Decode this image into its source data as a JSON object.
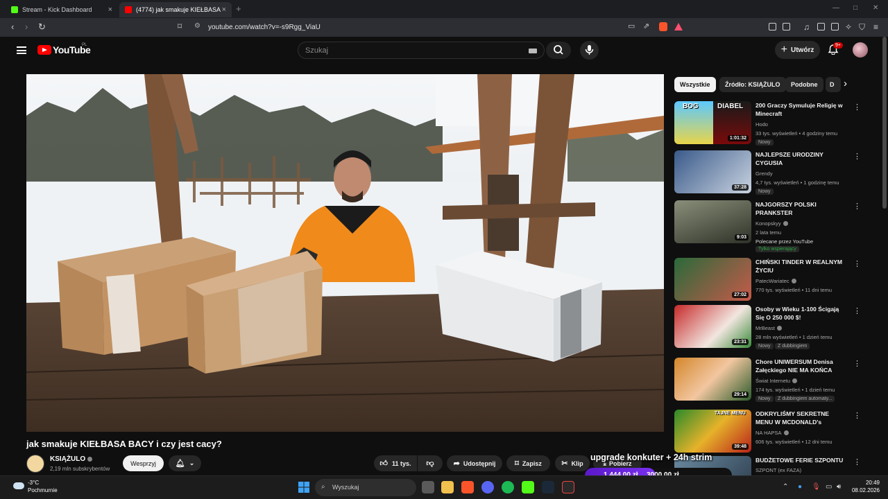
{
  "browser": {
    "tabs": [
      {
        "title": "Stream - Kick Dashboard",
        "favicon_color": "#53fc18"
      },
      {
        "title": "(4774) jak smakuje KIEŁBASA BACY",
        "favicon_color": "#ff0000"
      }
    ],
    "url": "youtube.com/watch?v=-s9Rgg_ViaU"
  },
  "youtube": {
    "logo_text": "YouTube",
    "country": "PL",
    "search_placeholder": "Szukaj",
    "create_label": "Utwórz",
    "notification_badge": "9+"
  },
  "video": {
    "title": "jak smakuje KIEŁBASA BACY i czy jest cacy?",
    "channel": "KSIĄŻULO",
    "subscribers": "2,19 mln subskrybentów",
    "support_label": "Wesprzyj",
    "likes": "11 tys.",
    "share_label": "Udostępnij",
    "save_label": "Zapisz",
    "clip_label": "Klip",
    "download_label": "Pobierz"
  },
  "chips": [
    "Wszystkie",
    "Źródło: KSIĄŻULO",
    "Podobne",
    "D"
  ],
  "recommended": [
    {
      "title": "200 Graczy Symuluje Religię w Minecraft",
      "channel": "Hodo",
      "meta": "33 tys. wyświetleń • 4 godziny temu",
      "tags": [
        "Nowy"
      ],
      "duration": "1:01:32",
      "thumb_text": [
        "BOG",
        "DIABEL"
      ]
    },
    {
      "title": "NAJLEPSZE URODZINY CYGUSIA",
      "channel": "Grendy",
      "meta": "4,7 tys. wyświetleń • 1 godzinę temu",
      "tags": [
        "Nowy"
      ],
      "duration": "37:28"
    },
    {
      "title": "NAJGORSZY POLSKI PRANKSTER",
      "channel": "Konopskyy",
      "meta": "2 lata temu",
      "promo": "Polecane przez YouTube",
      "members": "Tylko wspierający",
      "duration": "9:03"
    },
    {
      "title": "CHIŃSKI TINDER W REALNYM ŻYCIU",
      "channel": "PatecWariatec",
      "meta": "770 tys. wyświetleń • 11 dni temu",
      "duration": "27:02"
    },
    {
      "title": "Osoby w Wieku 1-100 Ścigają Się O 250 000 $!",
      "channel": "MrBeast",
      "meta": "28 mln wyświetleń • 1 dzień temu",
      "tags": [
        "Nowy",
        "Z dubbingiem"
      ],
      "duration": "23:31"
    },
    {
      "title": "Chore UNIWERSUM Denisa Załęckiego NIE MA KOŃCA",
      "channel": "Świat Internetu",
      "meta": "174 tys. wyświetleń • 1 dzień temu",
      "tags": [
        "Nowy",
        "Z dubbingiem automaty..."
      ],
      "duration": "29:14"
    },
    {
      "title": "ODKRYLIŚMY SEKRETNE MENU W MCDONALD's",
      "channel": "NA HAPSA",
      "meta": "606 tys. wyświetleń • 12 dni temu",
      "duration": "39:48",
      "thumb_text": [
        "TAJNE MENU"
      ]
    },
    {
      "title": "BUDŻETOWE FERIE SZPONTU",
      "channel": "SZPONT (ex FAZA)"
    }
  ],
  "stream_overlay": {
    "title": "upgrade konkuter + 24h strim",
    "current": "1 444,00 zł",
    "goal": "3000,00 zł",
    "progress": 0.48
  },
  "taskbar": {
    "temperature": "-3°C",
    "condition": "Pochmurnie",
    "search_label": "Wyszukaj",
    "time": "20:49",
    "date": "08.02.2026"
  },
  "colors": {
    "accent_red": "#ff0000",
    "kick_green": "#53fc18",
    "overlay_purple": "#6a22e0"
  }
}
